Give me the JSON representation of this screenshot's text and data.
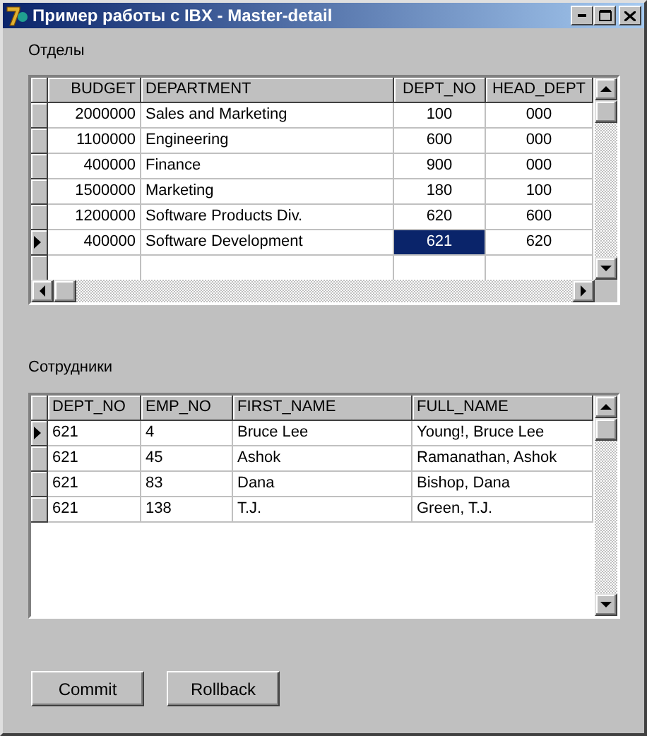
{
  "window": {
    "title": "Пример работы с IBX - Master-detail"
  },
  "departments": {
    "label": "Отделы",
    "columns": [
      {
        "label": "BUDGET"
      },
      {
        "label": "DEPARTMENT"
      },
      {
        "label": "DEPT_NO"
      },
      {
        "label": "HEAD_DEPT"
      }
    ],
    "rows": [
      {
        "selected": false,
        "cells": [
          {
            "text": "2000000",
            "selected": false
          },
          {
            "text": "Sales and Marketing",
            "selected": false
          },
          {
            "text": "100",
            "selected": false
          },
          {
            "text": "000",
            "selected": false
          }
        ]
      },
      {
        "selected": false,
        "cells": [
          {
            "text": "1100000",
            "selected": false
          },
          {
            "text": "Engineering",
            "selected": false
          },
          {
            "text": "600",
            "selected": false
          },
          {
            "text": "000",
            "selected": false
          }
        ]
      },
      {
        "selected": false,
        "cells": [
          {
            "text": "400000",
            "selected": false
          },
          {
            "text": "Finance",
            "selected": false
          },
          {
            "text": "900",
            "selected": false
          },
          {
            "text": "000",
            "selected": false
          }
        ]
      },
      {
        "selected": false,
        "cells": [
          {
            "text": "1500000",
            "selected": false
          },
          {
            "text": "Marketing",
            "selected": false
          },
          {
            "text": "180",
            "selected": false
          },
          {
            "text": "100",
            "selected": false
          }
        ]
      },
      {
        "selected": false,
        "cells": [
          {
            "text": "1200000",
            "selected": false
          },
          {
            "text": "Software Products Div.",
            "selected": false
          },
          {
            "text": "620",
            "selected": false
          },
          {
            "text": "600",
            "selected": false
          }
        ]
      },
      {
        "selected": true,
        "cells": [
          {
            "text": "400000",
            "selected": false
          },
          {
            "text": "Software Development",
            "selected": false
          },
          {
            "text": "621",
            "selected": true
          },
          {
            "text": "620",
            "selected": false
          }
        ]
      }
    ]
  },
  "employees": {
    "label": "Сотрудники",
    "columns": [
      {
        "label": "DEPT_NO"
      },
      {
        "label": "EMP_NO"
      },
      {
        "label": "FIRST_NAME"
      },
      {
        "label": "FULL_NAME"
      }
    ],
    "rows": [
      {
        "selected": true,
        "cells": [
          {
            "text": "621",
            "selected": false
          },
          {
            "text": "4",
            "selected": false
          },
          {
            "text": "Bruce Lee",
            "selected": false
          },
          {
            "text": "Young!, Bruce Lee",
            "selected": false
          }
        ]
      },
      {
        "selected": false,
        "cells": [
          {
            "text": "621",
            "selected": false
          },
          {
            "text": "45",
            "selected": false
          },
          {
            "text": "Ashok",
            "selected": false
          },
          {
            "text": "Ramanathan, Ashok",
            "selected": false
          }
        ]
      },
      {
        "selected": false,
        "cells": [
          {
            "text": "621",
            "selected": false
          },
          {
            "text": "83",
            "selected": false
          },
          {
            "text": "Dana",
            "selected": false
          },
          {
            "text": "Bishop, Dana",
            "selected": false
          }
        ]
      },
      {
        "selected": false,
        "cells": [
          {
            "text": "621",
            "selected": false
          },
          {
            "text": "138",
            "selected": false
          },
          {
            "text": "T.J.",
            "selected": false
          },
          {
            "text": "Green, T.J.",
            "selected": false
          }
        ]
      }
    ]
  },
  "buttons": [
    "Commit",
    "Rollback"
  ]
}
